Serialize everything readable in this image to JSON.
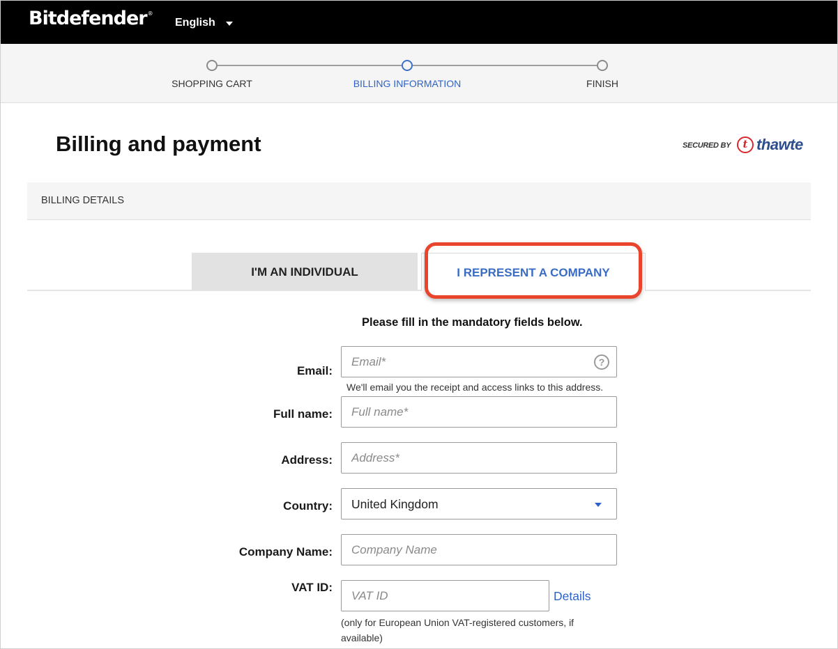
{
  "header": {
    "brand": "Bitdefender",
    "brand_mark": "®",
    "language": "English"
  },
  "stepper": {
    "steps": [
      {
        "label": "SHOPPING CART",
        "active": false
      },
      {
        "label": "BILLING INFORMATION",
        "active": true
      },
      {
        "label": "FINISH",
        "active": false
      }
    ]
  },
  "page": {
    "title": "Billing and payment",
    "secured_by": "SECURED BY",
    "seal_letter": "t",
    "seal_brand": "thawte"
  },
  "section": {
    "label": "BILLING DETAILS"
  },
  "tabs": {
    "individual": "I'M AN INDIVIDUAL",
    "company": "I REPRESENT A COMPANY",
    "selected": "company"
  },
  "form": {
    "instruction": "Please fill in the mandatory fields below.",
    "email": {
      "label": "Email:",
      "placeholder": "Email*",
      "hint": "We'll email you the receipt and access links to this address."
    },
    "full_name": {
      "label": "Full name:",
      "placeholder": "Full name*"
    },
    "address": {
      "label": "Address:",
      "placeholder": "Address*"
    },
    "country": {
      "label": "Country:",
      "value": "United Kingdom"
    },
    "company_name": {
      "label": "Company Name:",
      "placeholder": "Company Name"
    },
    "vat_id": {
      "label": "VAT ID:",
      "placeholder": "VAT ID",
      "details_link": "Details",
      "note": "(only for European Union VAT-registered customers, if available)"
    }
  },
  "colors": {
    "accent": "#2f62c9",
    "highlight": "#e8452c",
    "topbar": "#000000"
  },
  "icons": {
    "help": "question-circle-icon",
    "dropdown": "caret-down-icon"
  }
}
